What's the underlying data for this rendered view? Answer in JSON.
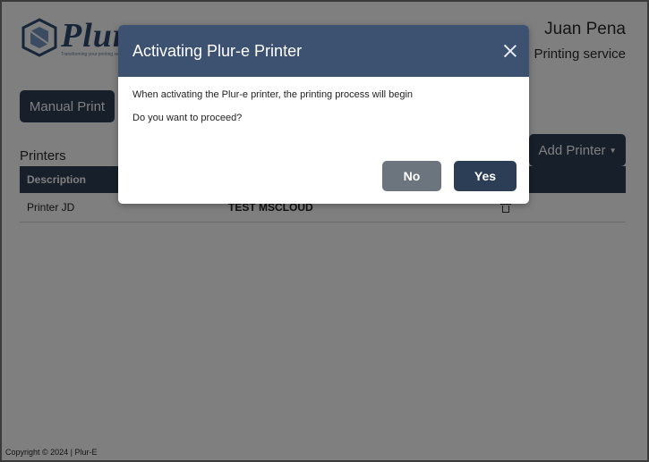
{
  "app": {
    "logo_text": "Plur-e",
    "logo_tagline": "Transforming your printing services"
  },
  "header": {
    "user_name": "Juan Pena",
    "service_label": "Printing service"
  },
  "toolbar": {
    "manual_print_label": "Manual Print",
    "add_printer_label": "Add Printer"
  },
  "printers": {
    "title": "Printers",
    "columns": [
      "Description",
      "",
      ""
    ],
    "rows": [
      {
        "description": "Printer JD",
        "name": "TEST MSCLOUD"
      }
    ]
  },
  "footer": {
    "copyright": "Copyright © 2024 | Plur-E"
  },
  "modal": {
    "title": "Activating Plur-e Printer",
    "message_line1": "When activating the Plur-e printer, the printing process will begin",
    "message_line2": "Do you want to proceed?",
    "no_label": "No",
    "yes_label": "Yes"
  },
  "colors": {
    "primary": "#2c3e55",
    "modal_header": "#3d5270",
    "secondary_button": "#6c757d"
  }
}
